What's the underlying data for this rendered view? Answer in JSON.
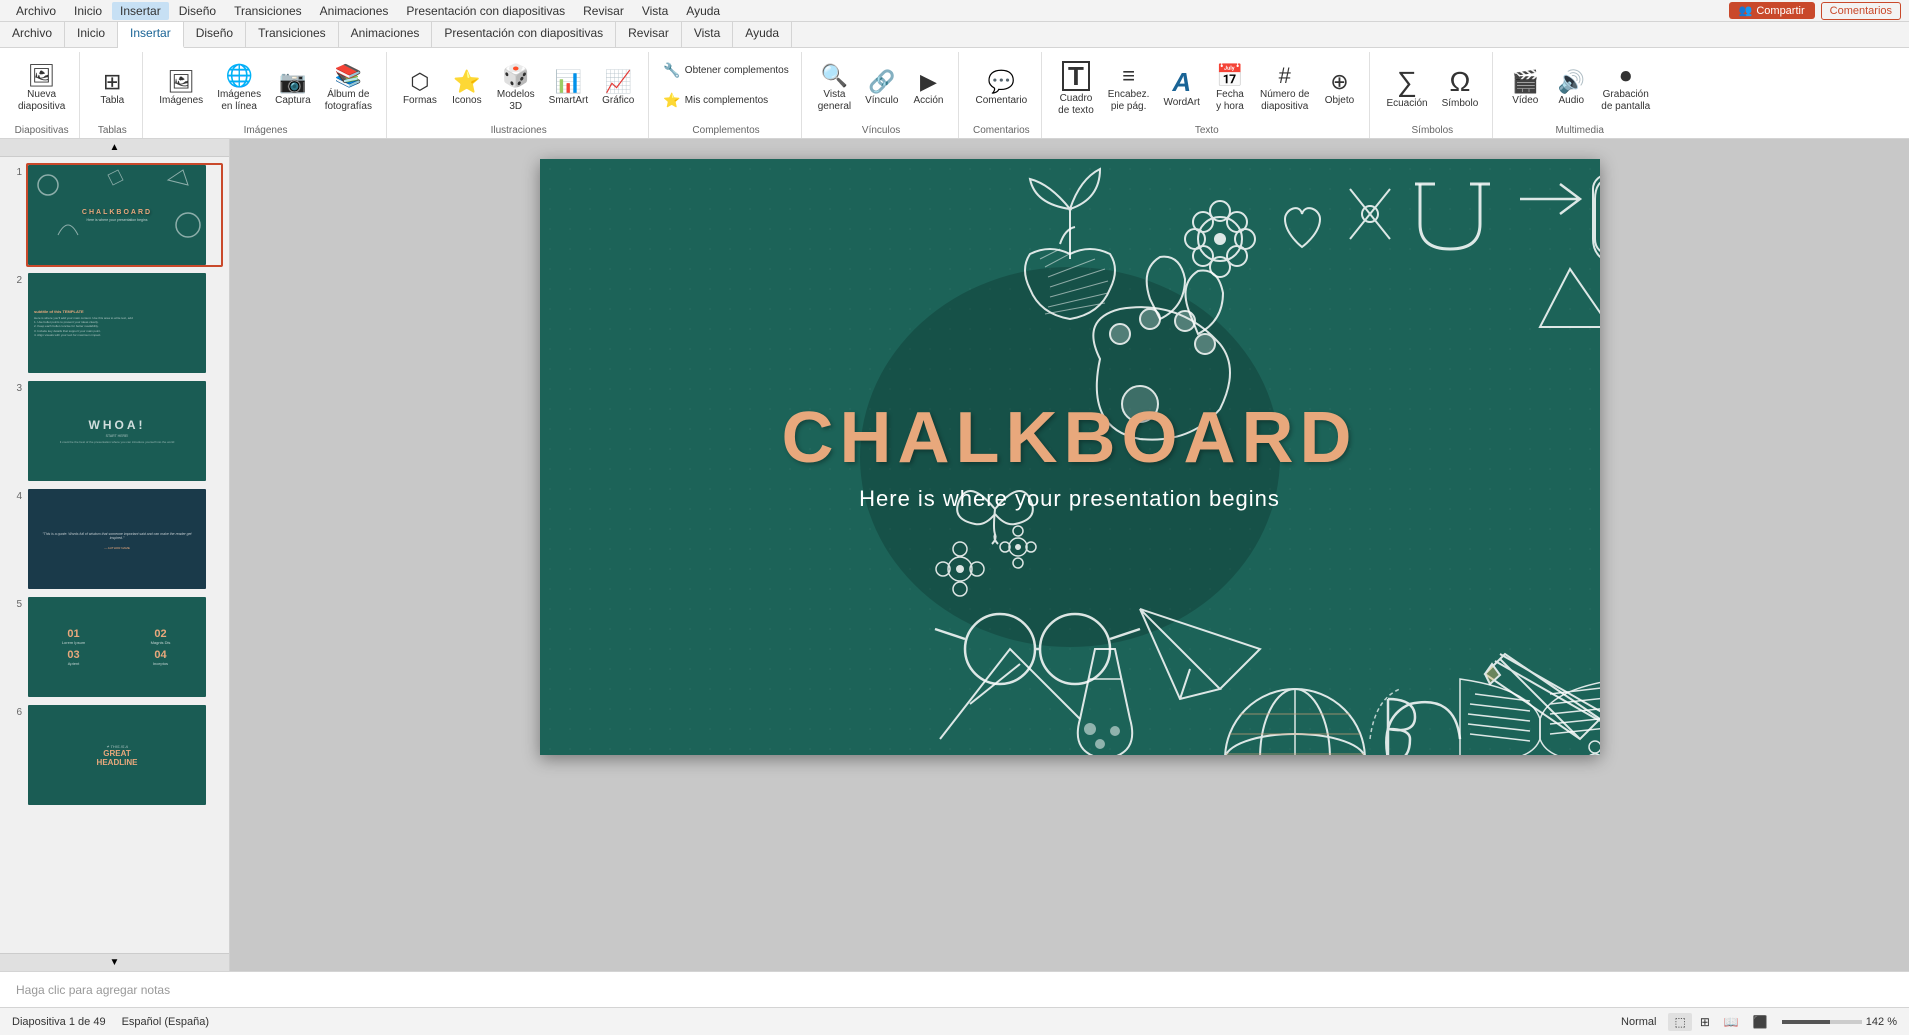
{
  "menubar": {
    "items": [
      "Archivo",
      "Inicio",
      "Insertar",
      "Diseño",
      "Transiciones",
      "Animaciones",
      "Presentación con diapositivas",
      "Revisar",
      "Vista",
      "Ayuda"
    ]
  },
  "ribbon": {
    "active_tab": "Insertar",
    "tabs": [
      "Archivo",
      "Inicio",
      "Insertar",
      "Diseño",
      "Transiciones",
      "Animaciones",
      "Presentación con diapositivas",
      "Revisar",
      "Vista",
      "Ayuda"
    ],
    "groups": {
      "diapositivas": {
        "label": "Diapositivas",
        "buttons": [
          {
            "label": "Nueva\ndiapositiva",
            "icon": "🖼"
          }
        ]
      },
      "tablas": {
        "label": "Tablas",
        "buttons": [
          {
            "label": "Tabla",
            "icon": "⊞"
          }
        ]
      },
      "imagenes": {
        "label": "Imágenes",
        "buttons": [
          {
            "label": "Imágenes",
            "icon": "🖼"
          },
          {
            "label": "Imágenes\nen línea",
            "icon": "🌐"
          },
          {
            "label": "Captura",
            "icon": "📷"
          },
          {
            "label": "Álbum de\nfotografías",
            "icon": "📚"
          }
        ]
      },
      "ilustraciones": {
        "label": "Ilustraciones",
        "buttons": [
          {
            "label": "Formas",
            "icon": "⬡"
          },
          {
            "label": "Iconos",
            "icon": "⭐"
          },
          {
            "label": "Modelos\n3D",
            "icon": "🎲"
          },
          {
            "label": "SmartArt",
            "icon": "📊"
          },
          {
            "label": "Gráfico",
            "icon": "📈"
          }
        ]
      },
      "complementos": {
        "label": "Complementos",
        "buttons": [
          {
            "label": "Obtener complementos",
            "icon": "🔧"
          },
          {
            "label": "Mis complementos",
            "icon": "⭐"
          }
        ]
      },
      "vinculos": {
        "label": "Vínculos",
        "buttons": [
          {
            "label": "Vista\ngeneral",
            "icon": "🔍"
          },
          {
            "label": "Vínculo",
            "icon": "🔗"
          },
          {
            "label": "Acción",
            "icon": "▶"
          }
        ]
      },
      "comentarios": {
        "label": "Comentarios",
        "buttons": [
          {
            "label": "Comentario",
            "icon": "💬"
          }
        ]
      },
      "texto": {
        "label": "Texto",
        "buttons": [
          {
            "label": "Cuadro\nde texto",
            "icon": "T"
          },
          {
            "label": "Encabez.\npie pág.",
            "icon": "≡"
          },
          {
            "label": "WordArt",
            "icon": "A"
          },
          {
            "label": "Fecha\ny hora",
            "icon": "📅"
          },
          {
            "label": "Número de\ndiapositiva",
            "icon": "#"
          },
          {
            "label": "Objeto",
            "icon": "⊕"
          }
        ]
      },
      "simbolos": {
        "label": "Símbolos",
        "buttons": [
          {
            "label": "Ecuación",
            "icon": "∑"
          },
          {
            "label": "Símbolo",
            "icon": "Ω"
          }
        ]
      },
      "multimedia": {
        "label": "Multimedia",
        "buttons": [
          {
            "label": "Vídeo",
            "icon": "🎬"
          },
          {
            "label": "Audio",
            "icon": "🔊"
          },
          {
            "label": "Grabación\nde pantalla",
            "icon": "⏺"
          }
        ]
      }
    },
    "share_label": "Compartir",
    "comments_label": "Comentarios"
  },
  "slides": [
    {
      "num": 1,
      "type": "chalkboard_title",
      "active": true
    },
    {
      "num": 2,
      "type": "content"
    },
    {
      "num": 3,
      "type": "whoai"
    },
    {
      "num": 4,
      "type": "quote"
    },
    {
      "num": 5,
      "type": "numbers"
    },
    {
      "num": 6,
      "type": "headline"
    }
  ],
  "main_slide": {
    "title": "CHALKBOARD",
    "subtitle": "Here is where your presentation begins",
    "background_color": "#1a5c54"
  },
  "status": {
    "slide_info": "Diapositiva 1 de 49",
    "language": "Español (España)",
    "notes_placeholder": "Haga clic para agregar notas",
    "zoom": "142 %",
    "view_normal": "Normal",
    "view_slide_sorter": "Clasificador",
    "view_reading": "Lectura",
    "view_presentation": "Presentación"
  }
}
